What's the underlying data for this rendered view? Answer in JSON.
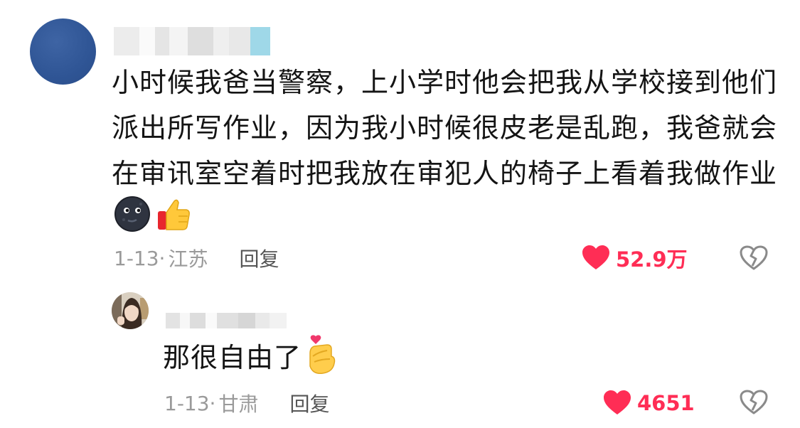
{
  "comment": {
    "text_lines": [
      "小时候我爸当警察，上小学时他会把我从学校接到他们",
      "派出所写作业，因为我小时候很皮老是乱跑，我爸就会",
      "在审讯室空着时把我放在审犯人的椅子上看着我做作业"
    ],
    "emojis": [
      "new-moon-face-icon",
      "thumbs-up-icon"
    ],
    "date": "1-13",
    "location": "江苏",
    "reply_label": "回复",
    "likes": "52.9万"
  },
  "reply": {
    "text": "那很自由了",
    "emoji": "finger-heart-icon",
    "date": "1-13",
    "location": "甘肃",
    "reply_label": "回复",
    "likes": "4651"
  },
  "colors": {
    "like": "#ff2d55",
    "meta": "#9a9a9a",
    "avatar_main": "#2f5595"
  }
}
